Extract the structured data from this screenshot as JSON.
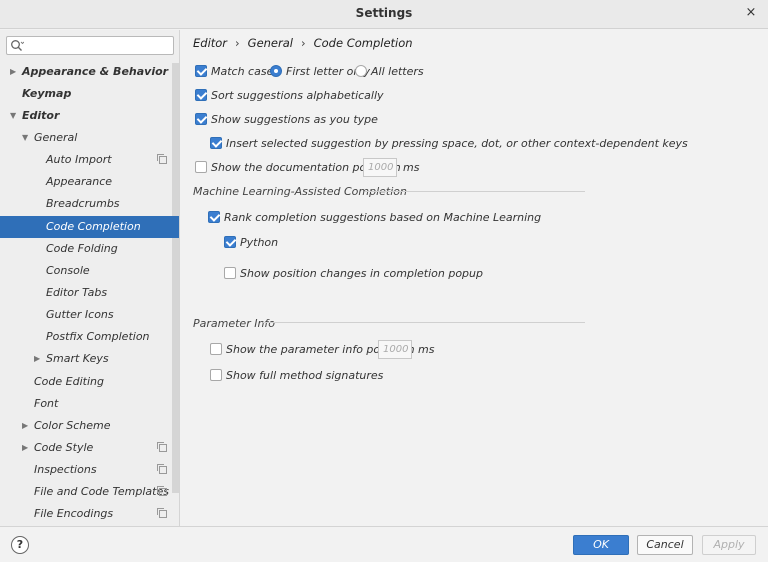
{
  "window": {
    "title": "Settings",
    "close_glyph": "×"
  },
  "search": {
    "value": "",
    "placeholder": ""
  },
  "sidebar": {
    "items": [
      {
        "label": "Appearance & Behavior",
        "arrow": "▶"
      },
      {
        "label": "Keymap",
        "arrow": ""
      },
      {
        "label": "Editor",
        "arrow": "▼"
      },
      {
        "label": "General",
        "arrow": "▼"
      },
      {
        "label": "Auto Import",
        "arrow": ""
      },
      {
        "label": "Appearance",
        "arrow": ""
      },
      {
        "label": "Breadcrumbs",
        "arrow": ""
      },
      {
        "label": "Code Completion",
        "arrow": ""
      },
      {
        "label": "Code Folding",
        "arrow": ""
      },
      {
        "label": "Console",
        "arrow": ""
      },
      {
        "label": "Editor Tabs",
        "arrow": ""
      },
      {
        "label": "Gutter Icons",
        "arrow": ""
      },
      {
        "label": "Postfix Completion",
        "arrow": ""
      },
      {
        "label": "Smart Keys",
        "arrow": "▶"
      },
      {
        "label": "Code Editing",
        "arrow": ""
      },
      {
        "label": "Font",
        "arrow": ""
      },
      {
        "label": "Color Scheme",
        "arrow": "▶"
      },
      {
        "label": "Code Style",
        "arrow": "▶"
      },
      {
        "label": "Inspections",
        "arrow": ""
      },
      {
        "label": "File and Code Templates",
        "arrow": ""
      },
      {
        "label": "File Encodings",
        "arrow": ""
      }
    ]
  },
  "breadcrumb": {
    "items": [
      "Editor",
      "General",
      "Code Completion"
    ],
    "separator": "›"
  },
  "options": {
    "match_case": {
      "label": "Match case:",
      "checked": true
    },
    "first_letter_only": {
      "label": "First letter only",
      "selected": true
    },
    "all_letters": {
      "label": "All letters",
      "selected": false
    },
    "sort_alpha": {
      "label": "Sort suggestions alphabetically",
      "checked": true
    },
    "show_as_you_type": {
      "label": "Show suggestions as you type",
      "checked": true
    },
    "insert_selected": {
      "label": "Insert selected suggestion by pressing space, dot, or other context-dependent keys",
      "checked": true
    },
    "show_doc_popup": {
      "label": "Show the documentation popup in",
      "checked": false,
      "value": "1000",
      "unit": "ms"
    }
  },
  "ml_section": {
    "title": "Machine Learning-Assisted Completion",
    "rank": {
      "label": "Rank completion suggestions based on Machine Learning",
      "checked": true
    },
    "python": {
      "label": "Python",
      "checked": true
    },
    "show_position_changes": {
      "label": "Show position changes in completion popup",
      "checked": false
    }
  },
  "param_section": {
    "title": "Parameter Info",
    "show_param_popup": {
      "label": "Show the parameter info popup in",
      "checked": false,
      "value": "1000",
      "unit": "ms"
    },
    "full_signatures": {
      "label": "Show full method signatures",
      "checked": false
    }
  },
  "footer": {
    "help_label": "?",
    "ok_label": "OK",
    "cancel_label": "Cancel",
    "apply_label": "Apply"
  },
  "colors": {
    "accent": "#3b7ed0",
    "selection": "#2f6fb8"
  }
}
